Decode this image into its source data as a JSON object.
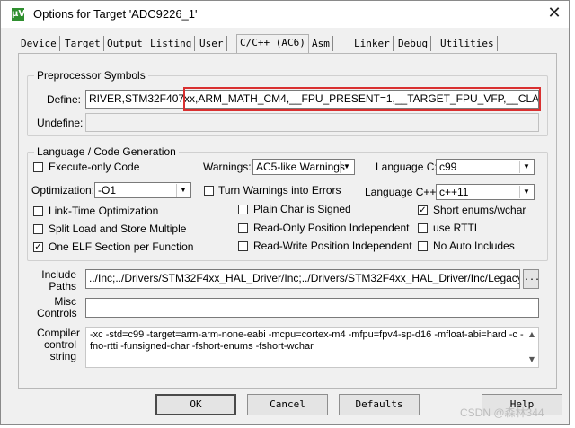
{
  "window": {
    "title": "Options for Target 'ADC9226_1'",
    "app_icon": "μV",
    "close_glyph": "✕"
  },
  "tabs": [
    "Device",
    "Target",
    "Output",
    "Listing",
    "User",
    "C/C++ (AC6)",
    "Asm",
    "Linker",
    "Debug",
    "Utilities"
  ],
  "active_tab": "C/C++ (AC6)",
  "preprocessor": {
    "group_title": "Preprocessor Symbols",
    "define_label": "Define:",
    "define_value": "RIVER,STM32F407xx,ARM_MATH_CM4,__FPU_PRESENT=1,__TARGET_FPU_VFP,__CLANG_ARM",
    "undefine_label": "Undefine:",
    "undefine_value": ""
  },
  "language": {
    "group_title": "Language / Code Generation",
    "execute_only": {
      "label": "Execute-only Code",
      "checked": false
    },
    "optimization_label": "Optimization:",
    "optimization_value": "-O1",
    "link_time": {
      "label": "Link-Time Optimization",
      "checked": false
    },
    "split_load": {
      "label": "Split Load and Store Multiple",
      "checked": false
    },
    "one_elf": {
      "label": "One ELF Section per Function",
      "checked": true
    },
    "warnings_label": "Warnings:",
    "warnings_value": "AC5-like Warnings",
    "turn_warnings_errors": {
      "label": "Turn Warnings into Errors",
      "checked": false
    },
    "plain_char": {
      "label": "Plain Char is Signed",
      "checked": false
    },
    "ropi": {
      "label": "Read-Only Position Independent",
      "checked": false
    },
    "rwpi": {
      "label": "Read-Write Position Independent",
      "checked": false
    },
    "language_c_label": "Language C:",
    "language_c_value": "c99",
    "language_cpp_label": "Language C++:",
    "language_cpp_value": "c++11",
    "short_enums": {
      "label": "Short enums/wchar",
      "checked": true
    },
    "use_rtti": {
      "label": "use RTTI",
      "checked": false
    },
    "no_auto_includes": {
      "label": "No Auto Includes",
      "checked": false
    }
  },
  "include": {
    "label_line1": "Include",
    "label_line2": "Paths",
    "value": "../Inc;../Drivers/STM32F4xx_HAL_Driver/Inc;../Drivers/STM32F4xx_HAL_Driver/Inc/Legacy;../Driv",
    "browse_label": "..."
  },
  "misc": {
    "label_line1": "Misc",
    "label_line2": "Controls",
    "value": ""
  },
  "compiler": {
    "label_line1": "Compiler",
    "label_line2": "control",
    "label_line3": "string",
    "value": "-xc -std=c99 -target=arm-arm-none-eabi -mcpu=cortex-m4 -mfpu=fpv4-sp-d16 -mfloat-abi=hard -c -fno-rtti -funsigned-char -fshort-enums -fshort-wchar"
  },
  "buttons": {
    "ok": "OK",
    "cancel": "Cancel",
    "defaults": "Defaults",
    "help": "Help"
  },
  "watermark": "CSDN @森林344",
  "colors": {
    "highlight_box": "#d93030",
    "title_icon": "#2f8f2f"
  }
}
